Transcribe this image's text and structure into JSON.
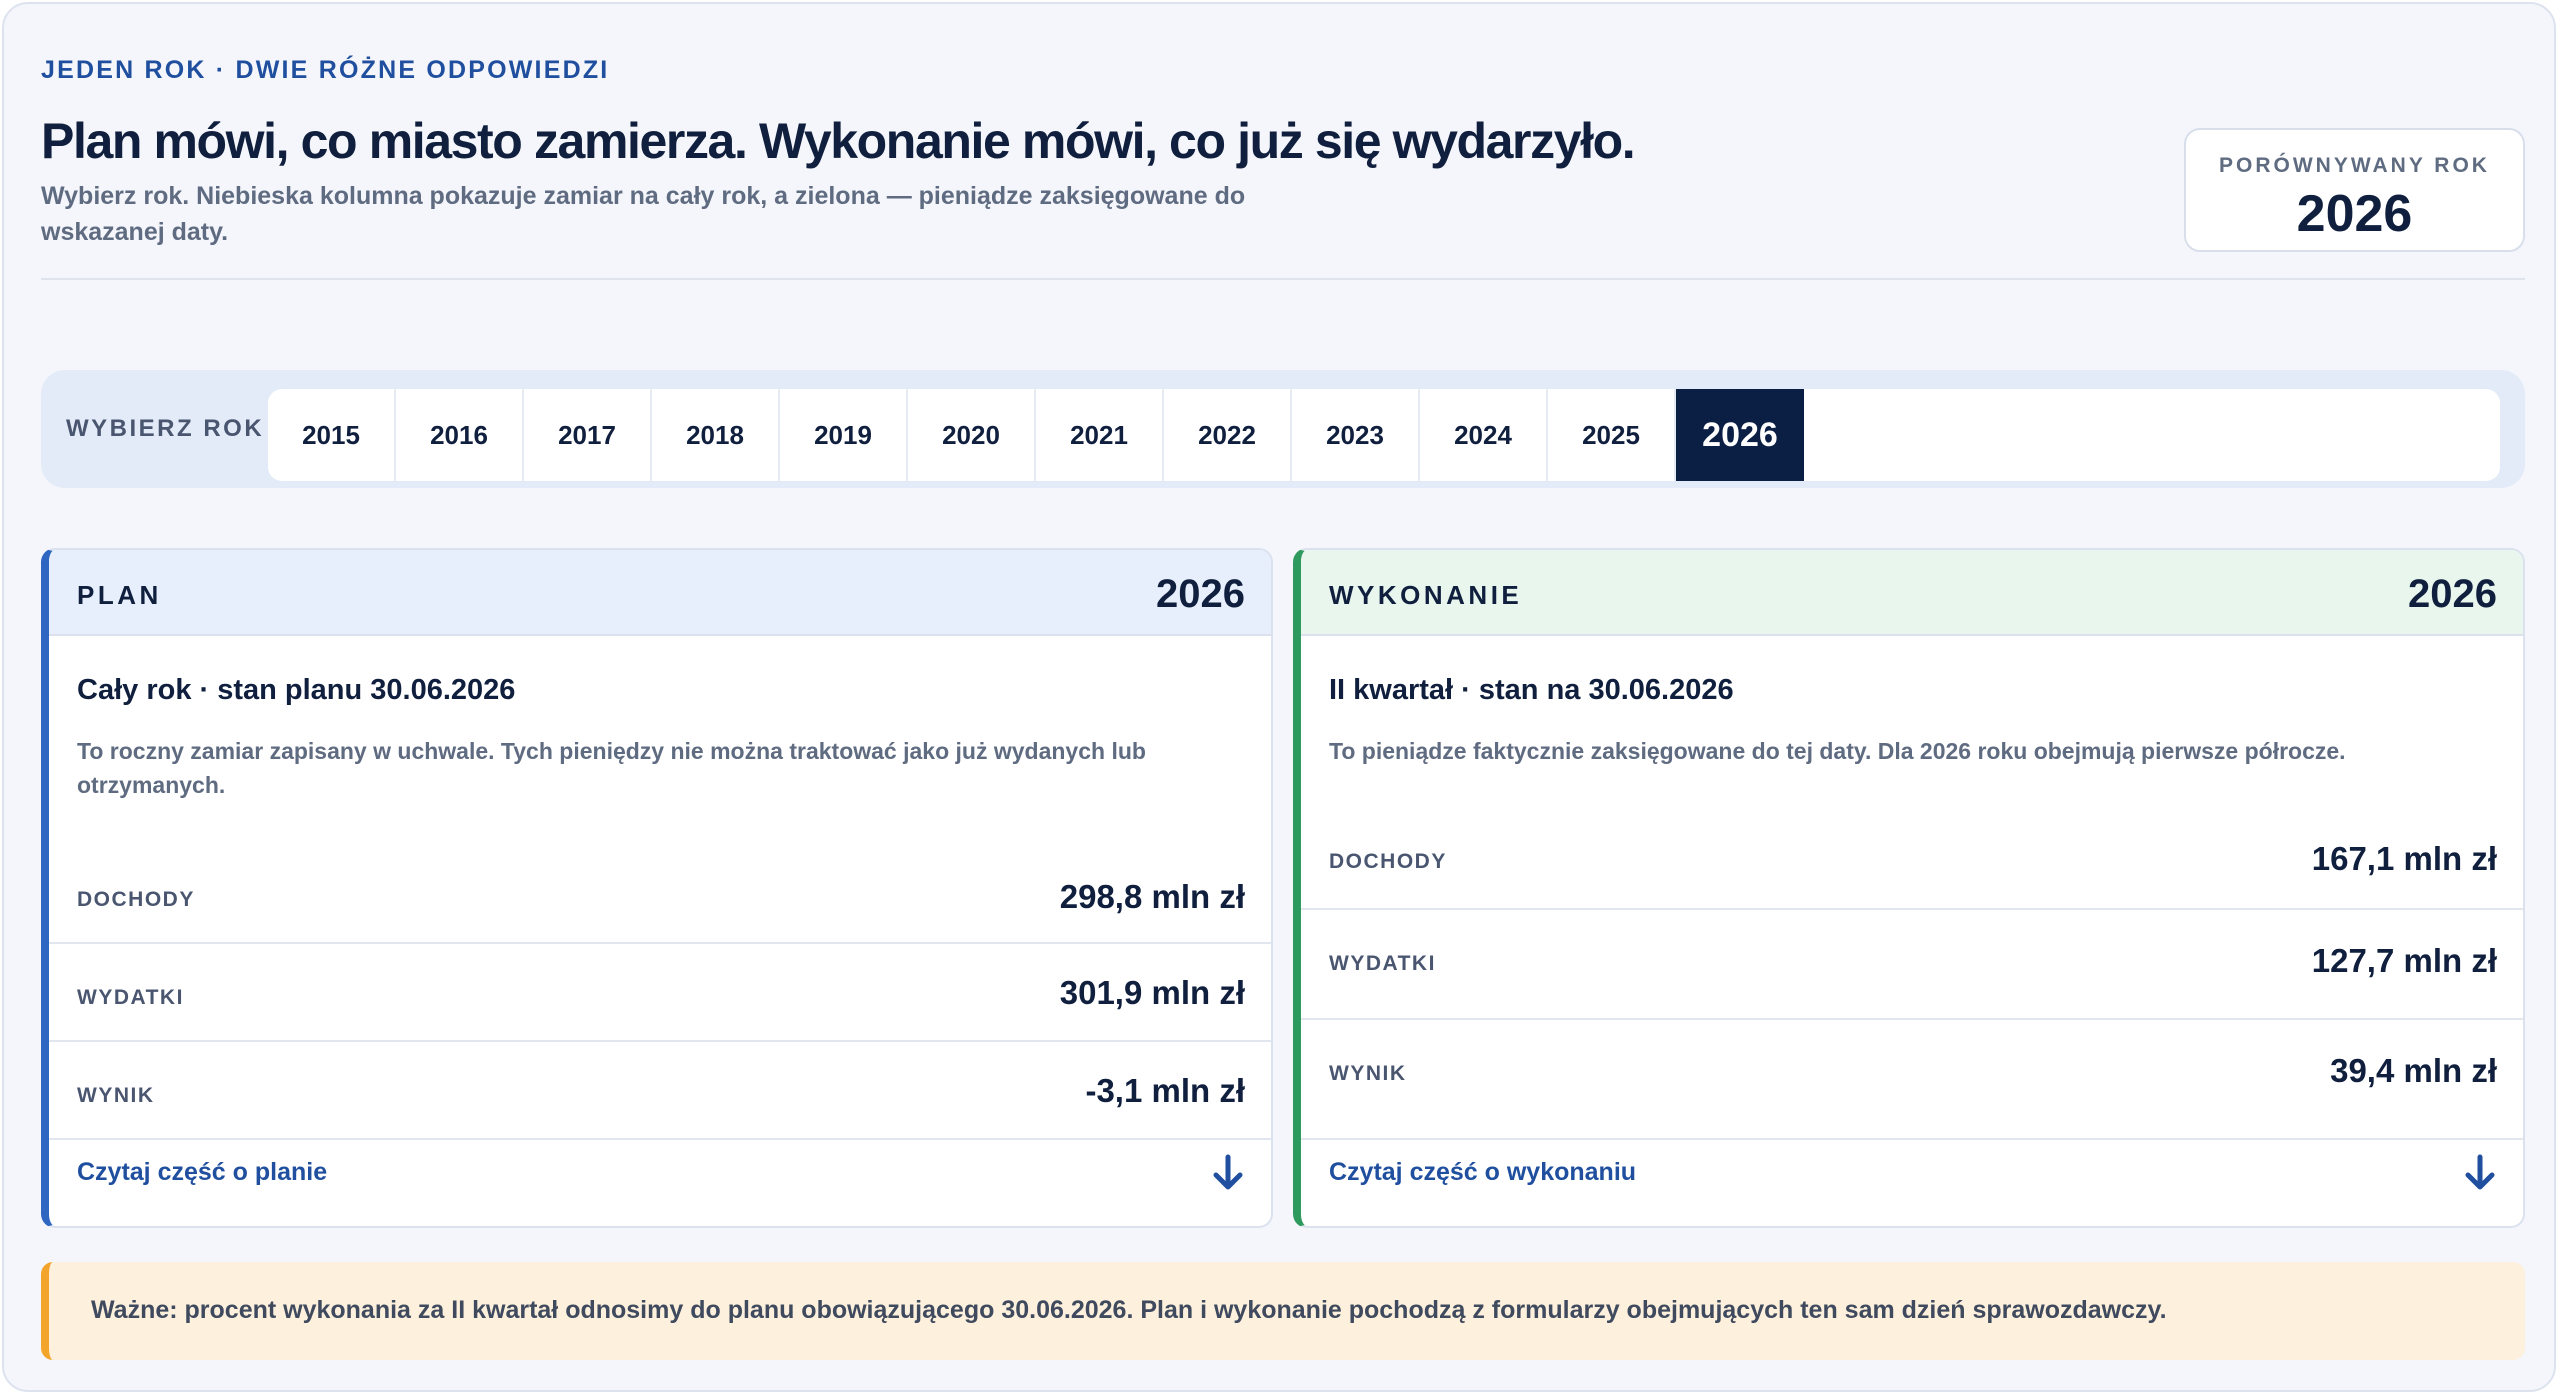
{
  "header": {
    "eyebrow": "JEDEN ROK · DWIE RÓŻNE ODPOWIEDZI",
    "title": "Plan mówi, co miasto zamierza. Wykonanie mówi, co już się wydarzyło.",
    "subtitle": "Wybierz rok. Niebieska kolumna pokazuje zamiar na cały rok, a zielona — pieniądze zaksięgowane do wskazanej daty."
  },
  "compared_year": {
    "label": "PORÓWNYWANY ROK",
    "value": "2026"
  },
  "year_picker": {
    "label": "WYBIERZ ROK",
    "years": [
      "2015",
      "2016",
      "2017",
      "2018",
      "2019",
      "2020",
      "2021",
      "2022",
      "2023",
      "2024",
      "2025",
      "2026"
    ],
    "selected": "2026"
  },
  "plan": {
    "name": "PLAN",
    "year": "2026",
    "subtitle": "Cały rok · stan planu 30.06.2026",
    "description": "To roczny zamiar zapisany w uchwale. Tych pieniędzy nie można traktować jako już wydanych lub otrzymanych.",
    "rows": [
      {
        "label": "DOCHODY",
        "value": "298,8 mln zł"
      },
      {
        "label": "WYDATKI",
        "value": "301,9 mln zł"
      },
      {
        "label": "WYNIK",
        "value": "-3,1 mln zł"
      }
    ],
    "link": "Czytaj część o planie",
    "accent": "#2f66c2",
    "icon": "arrow-down-icon"
  },
  "execution": {
    "name": "WYKONANIE",
    "year": "2026",
    "subtitle": "II kwartał · stan na 30.06.2026",
    "description": "To pieniądze faktycznie zaksięgowane do tej daty. Dla 2026 roku obejmują pierwsze półrocze.",
    "rows": [
      {
        "label": "DOCHODY",
        "value": "167,1 mln zł"
      },
      {
        "label": "WYDATKI",
        "value": "127,7 mln zł"
      },
      {
        "label": "WYNIK",
        "value": "39,4 mln zł"
      }
    ],
    "link": "Czytaj część o wykonaniu",
    "accent": "#2f9a5e",
    "icon": "arrow-down-icon"
  },
  "note": {
    "text": "Ważne: procent wykonania za II kwartał odnosimy do planu obowiązującego 30.06.2026. Plan i wykonanie pochodzą z formularzy obejmujących ten sam dzień sprawozdawczy.",
    "accent": "#f2a52a"
  }
}
